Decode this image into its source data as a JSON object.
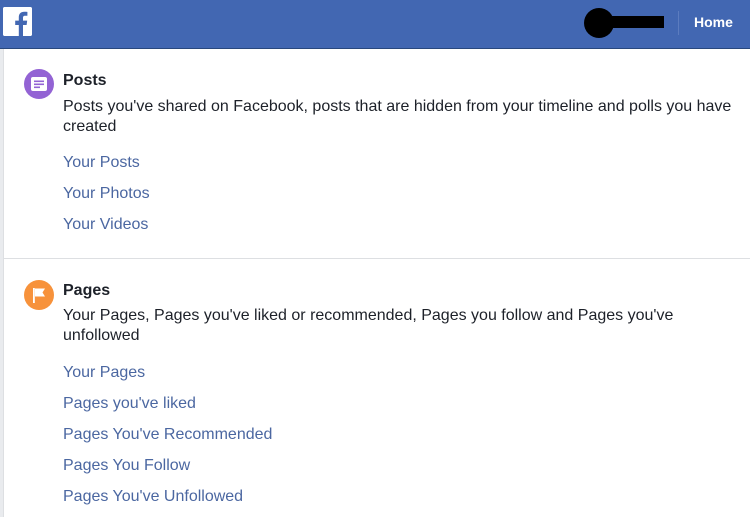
{
  "header": {
    "home_label": "Home",
    "brand_color": "#4267b2"
  },
  "sections": [
    {
      "title": "Posts",
      "icon": "posts-icon",
      "icon_color": "#9363d4",
      "description": "Posts you've shared on Facebook, posts that are hidden from your timeline and polls you have created",
      "links": [
        "Your Posts",
        "Your Photos",
        "Your Videos"
      ]
    },
    {
      "title": "Pages",
      "icon": "flag-icon",
      "icon_color": "#f7923b",
      "description": "Your Pages, Pages you've liked or recommended, Pages you follow and Pages you've unfollowed",
      "links": [
        "Your Pages",
        "Pages you've liked",
        "Pages You've Recommended",
        "Pages You Follow",
        "Pages You've Unfollowed"
      ]
    }
  ],
  "link_color": "#4b67a1"
}
